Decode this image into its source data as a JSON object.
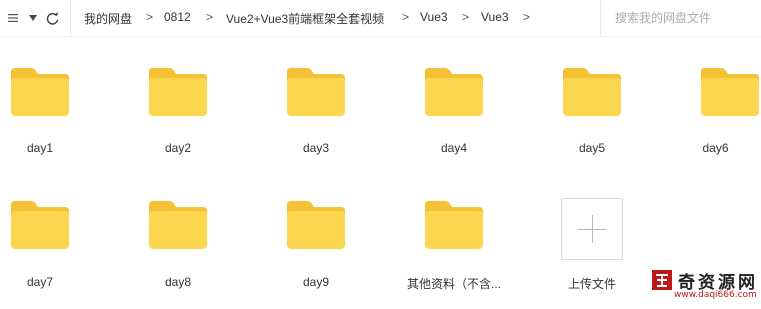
{
  "toolbar": {
    "menu_icon": "caret-down-icon",
    "refresh_icon": "refresh-icon"
  },
  "breadcrumb": [
    {
      "label": "我的网盘"
    },
    {
      "label": "0812"
    },
    {
      "label": "Vue2+Vue3前端框架全套视频"
    },
    {
      "label": "Vue3"
    },
    {
      "label": "Vue3"
    }
  ],
  "breadcrumb_separator": ">",
  "search": {
    "placeholder": "搜索我的网盘文件",
    "value": ""
  },
  "files": [
    {
      "name": "day1",
      "type": "folder"
    },
    {
      "name": "day2",
      "type": "folder"
    },
    {
      "name": "day3",
      "type": "folder"
    },
    {
      "name": "day4",
      "type": "folder"
    },
    {
      "name": "day5",
      "type": "folder"
    },
    {
      "name": "day6",
      "type": "folder"
    },
    {
      "name": "day7",
      "type": "folder"
    },
    {
      "name": "day8",
      "type": "folder"
    },
    {
      "name": "day9",
      "type": "folder"
    },
    {
      "name": "其他资料（不含...",
      "type": "folder"
    }
  ],
  "upload": {
    "label": "上传文件",
    "icon": "plus-icon"
  },
  "watermark": {
    "title": "奇资源网",
    "url": "www.daqi666.com"
  },
  "colors": {
    "folder_body": "#FDD64F",
    "folder_tab": "#F5C235",
    "accent_red": "#c01818"
  }
}
